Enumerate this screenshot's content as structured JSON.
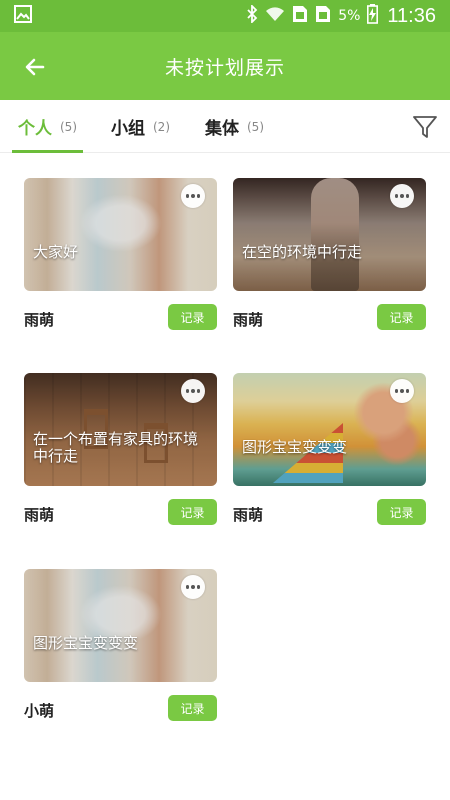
{
  "status_bar": {
    "battery": "5%",
    "time": "11:36",
    "icons": [
      "image-icon",
      "bluetooth-icon",
      "wifi-icon",
      "sim-icon",
      "sim-icon",
      "battery-charging-icon"
    ]
  },
  "header": {
    "title": "未按计划展示",
    "back_icon": "arrow-left-icon"
  },
  "tabs": [
    {
      "label": "个人",
      "count": "(5)",
      "active": true
    },
    {
      "label": "小组",
      "count": "(2)",
      "active": false
    },
    {
      "label": "集体",
      "count": "(5)",
      "active": false
    }
  ],
  "filter_icon": "funnel-icon",
  "accent_color": "#7ac943",
  "cards": [
    {
      "caption": "大家好",
      "name": "雨萌",
      "button": "记录",
      "more_icon": "more-horizontal-icon"
    },
    {
      "caption": "在空的环境中行走",
      "name": "雨萌",
      "button": "记录",
      "more_icon": "more-horizontal-icon"
    },
    {
      "caption": "在一个布置有家具的环境中行走",
      "name": "雨萌",
      "button": "记录",
      "more_icon": "more-horizontal-icon"
    },
    {
      "caption": "图形宝宝变变变",
      "name": "雨萌",
      "button": "记录",
      "more_icon": "more-horizontal-icon"
    },
    {
      "caption": "图形宝宝变变变",
      "name": "小萌",
      "button": "记录",
      "more_icon": "more-horizontal-icon"
    }
  ]
}
